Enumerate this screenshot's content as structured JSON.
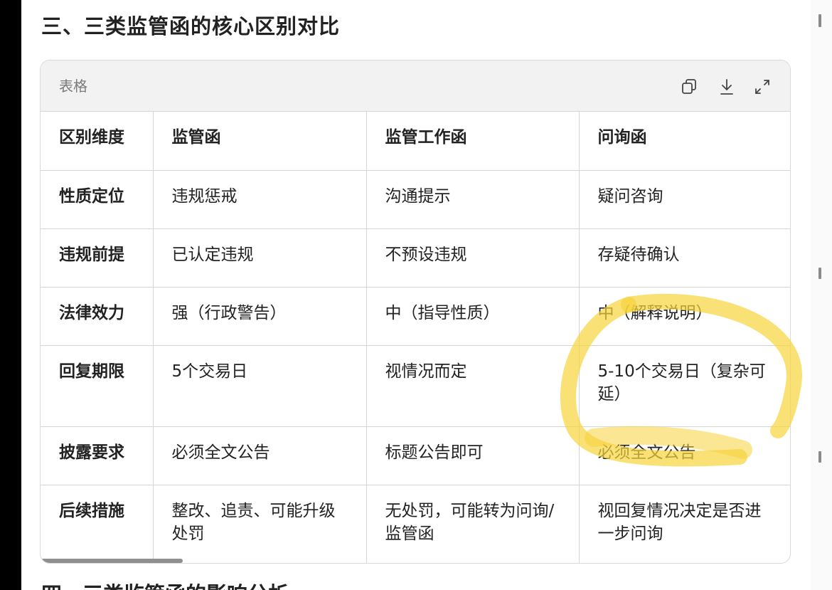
{
  "section_title": "三、三类监管函的核心区别对比",
  "table_card": {
    "label": "表格",
    "tools": [
      "copy-icon",
      "download-icon",
      "expand-icon"
    ]
  },
  "table": {
    "header": [
      "区别维度",
      "监管函",
      "监管工作函",
      "问询函"
    ],
    "rows": [
      [
        "性质定位",
        "违规惩戒",
        "沟通提示",
        "疑问咨询"
      ],
      [
        "违规前提",
        "已认定违规",
        "不预设违规",
        "存疑待确认"
      ],
      [
        "法律效力",
        "强（行政警告）",
        "中（指导性质）",
        "中（解释说明）"
      ],
      [
        "回复期限",
        "5个交易日",
        "视情况而定",
        "5-10个交易日（复杂可延）"
      ],
      [
        "披露要求",
        "必须全文公告",
        "标题公告即可",
        "必须全文公告"
      ],
      [
        "后续措施",
        "整改、追责、可能升级处罚",
        "无处罚，可能转为问询/监管函",
        "视回复情况决定是否进一步问询"
      ]
    ]
  },
  "next_section_title": "四、三类监管函的影响分析",
  "colors": {
    "highlighter": "#f7d43a",
    "header_bg": "#f2f2f2",
    "border": "#d5d5d5"
  }
}
